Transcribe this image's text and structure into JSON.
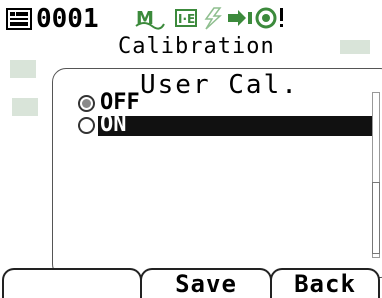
{
  "header": {
    "target_number": "0001",
    "icons": [
      "target-data-icon",
      "measurement-mode-icon",
      "specular-mode-icon",
      "flash-icon",
      "connection-icon",
      "warning-icon"
    ]
  },
  "screen": {
    "title": "Calibration"
  },
  "dialog": {
    "title": "User Cal.",
    "options": [
      {
        "label": "OFF",
        "selected": true,
        "highlighted": false
      },
      {
        "label": "ON",
        "selected": false,
        "highlighted": true
      }
    ]
  },
  "softkeys": {
    "left": "",
    "middle": "Save",
    "right": "Back"
  },
  "colors": {
    "highlight": "#111111",
    "radio_fill": "#8a8a8a"
  }
}
